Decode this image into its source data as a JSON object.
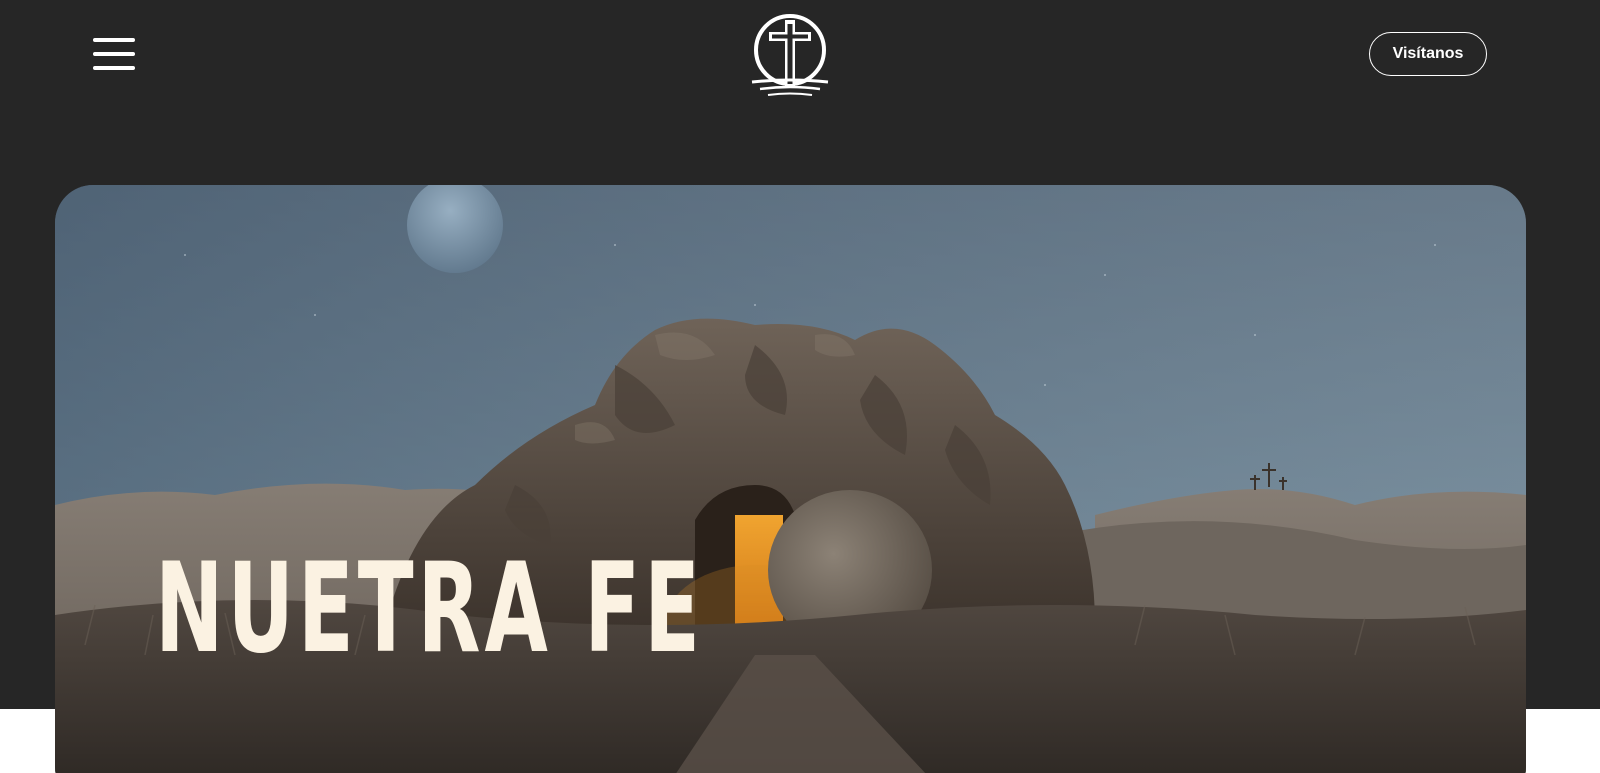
{
  "header": {
    "menu_icon": "hamburger-menu-icon",
    "logo_icon": "cross-circle-logo-icon",
    "visit_button_label": "Visítanos"
  },
  "hero": {
    "title": "NUETRA FE"
  },
  "colors": {
    "header_background": "#262626",
    "page_background": "#ffffff",
    "title_text": "#fbf2e2",
    "button_border": "#ffffff"
  }
}
